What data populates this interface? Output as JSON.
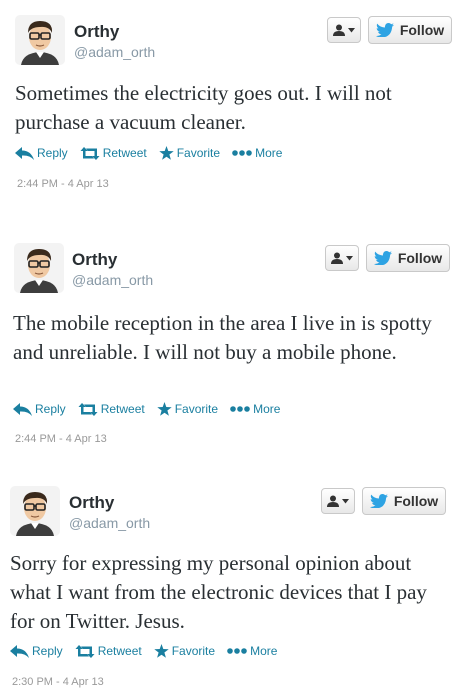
{
  "colors": {
    "link": "#1a7fa0",
    "twitter_blue": "#2ea3e3",
    "meta_gray": "#999999"
  },
  "tweets": [
    {
      "name": "Orthy",
      "handle": "@adam_orth",
      "follow_label": "Follow",
      "text": "Sometimes the electricity goes out. I will not purchase a vacuum cleaner.",
      "actions": {
        "reply": "Reply",
        "retweet": "Retweet",
        "favorite": "Favorite",
        "more": "More"
      },
      "timestamp": "2:44 PM - 4 Apr 13"
    },
    {
      "name": "Orthy",
      "handle": "@adam_orth",
      "follow_label": "Follow",
      "text": "The mobile reception in the area I live in is spotty and unreliable. I will not buy a mobile phone.",
      "actions": {
        "reply": "Reply",
        "retweet": "Retweet",
        "favorite": "Favorite",
        "more": "More"
      },
      "timestamp": "2:44 PM - 4 Apr 13"
    },
    {
      "name": "Orthy",
      "handle": "@adam_orth",
      "follow_label": "Follow",
      "text": "Sorry for expressing my personal opinion about what I want from the electronic devices that I pay for on Twitter. Jesus.",
      "actions": {
        "reply": "Reply",
        "retweet": "Retweet",
        "favorite": "Favorite",
        "more": "More"
      },
      "timestamp": "2:30 PM - 4 Apr 13"
    }
  ]
}
